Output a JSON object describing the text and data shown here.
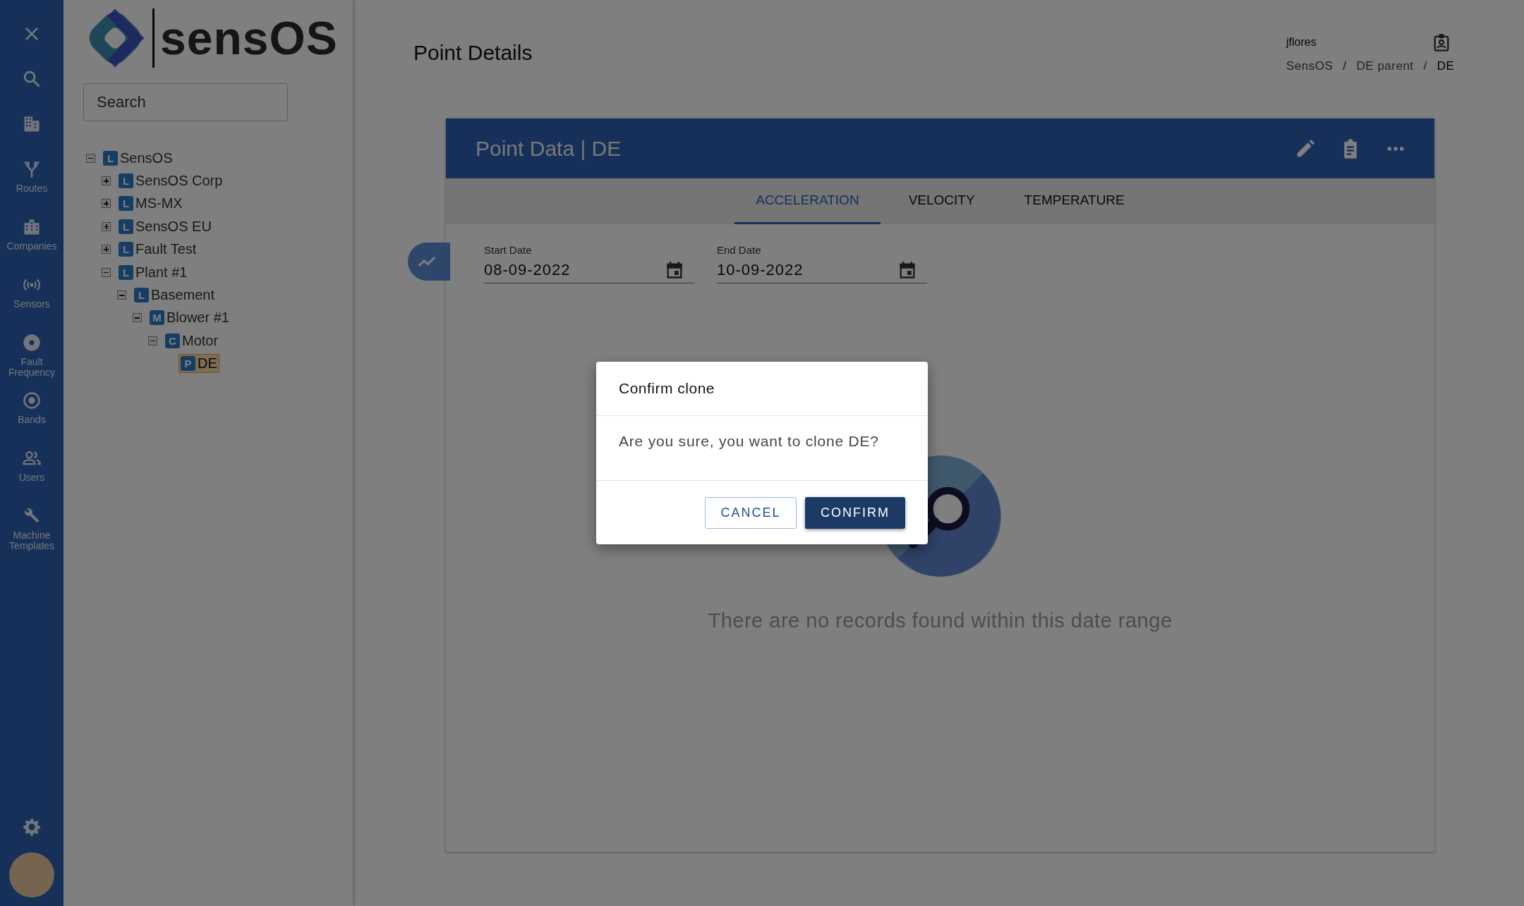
{
  "nav": {
    "items": [
      {
        "kind": "close"
      },
      {
        "kind": "search"
      },
      {
        "kind": "building"
      },
      {
        "kind": "routes",
        "label": "Routes"
      },
      {
        "kind": "companies",
        "label": "Companies"
      },
      {
        "kind": "sensors",
        "label": "Sensors"
      },
      {
        "kind": "fault",
        "label": "Fault Frequency"
      },
      {
        "kind": "bands",
        "label": "Bands"
      },
      {
        "kind": "users",
        "label": "Users"
      },
      {
        "kind": "wrench",
        "label": "Machine Templates"
      }
    ],
    "bottom": [
      {
        "kind": "settings"
      },
      {
        "kind": "avatar"
      }
    ]
  },
  "sidebar": {
    "logo": "sensOS",
    "search": {
      "placeholder": "Search"
    },
    "tree": [
      {
        "badge": "L",
        "label": "SensOS",
        "expanded": true,
        "selected": false,
        "children": [
          {
            "badge": "L",
            "label": "SensOS Corp",
            "expanded": false,
            "selected": false
          },
          {
            "badge": "L",
            "label": "MS-MX",
            "expanded": false,
            "selected": false
          },
          {
            "badge": "L",
            "label": "SensOS EU",
            "expanded": false,
            "selected": false
          },
          {
            "badge": "L",
            "label": "Fault Test",
            "expanded": false,
            "selected": false
          },
          {
            "badge": "L",
            "label": "Plant #1",
            "expanded": true,
            "selected": false,
            "children": [
              {
                "badge": "L",
                "label": "Basement",
                "expanded": true,
                "selected": false,
                "children": [
                  {
                    "badge": "M",
                    "label": "Blower #1",
                    "expanded": true,
                    "selected": false,
                    "children": [
                      {
                        "badge": "C",
                        "label": "Motor",
                        "expanded": true,
                        "selected": false,
                        "children": [
                          {
                            "badge": "P",
                            "label": "DE",
                            "selected": true
                          }
                        ]
                      }
                    ]
                  }
                ]
              }
            ]
          }
        ]
      }
    ]
  },
  "header": {
    "title": "Point Details",
    "user": "jflores",
    "breadcrumb_separator": "/",
    "breadcrumb": [
      {
        "label": "SensOS",
        "current": false
      },
      {
        "label": "DE parent",
        "current": false
      },
      {
        "label": "DE",
        "current": true
      }
    ]
  },
  "card": {
    "title": "Point Data | DE",
    "tabs": [
      {
        "label": "ACCELERATION",
        "selected": true
      },
      {
        "label": "VELOCITY",
        "selected": false
      },
      {
        "label": "TEMPERATURE",
        "selected": false
      }
    ],
    "fields": [
      {
        "label": "Start Date",
        "value": "08-09-2022"
      },
      {
        "label": "End Date",
        "value": "10-09-2022"
      }
    ],
    "empty_message": "There are no records found within this date range"
  },
  "dialog": {
    "title": "Confirm clone",
    "message": "Are you sure, you want to clone DE?",
    "buttons": [
      {
        "label": "CANCEL",
        "kind": "outlined"
      },
      {
        "label": "CONFIRM",
        "kind": "primary"
      }
    ]
  }
}
